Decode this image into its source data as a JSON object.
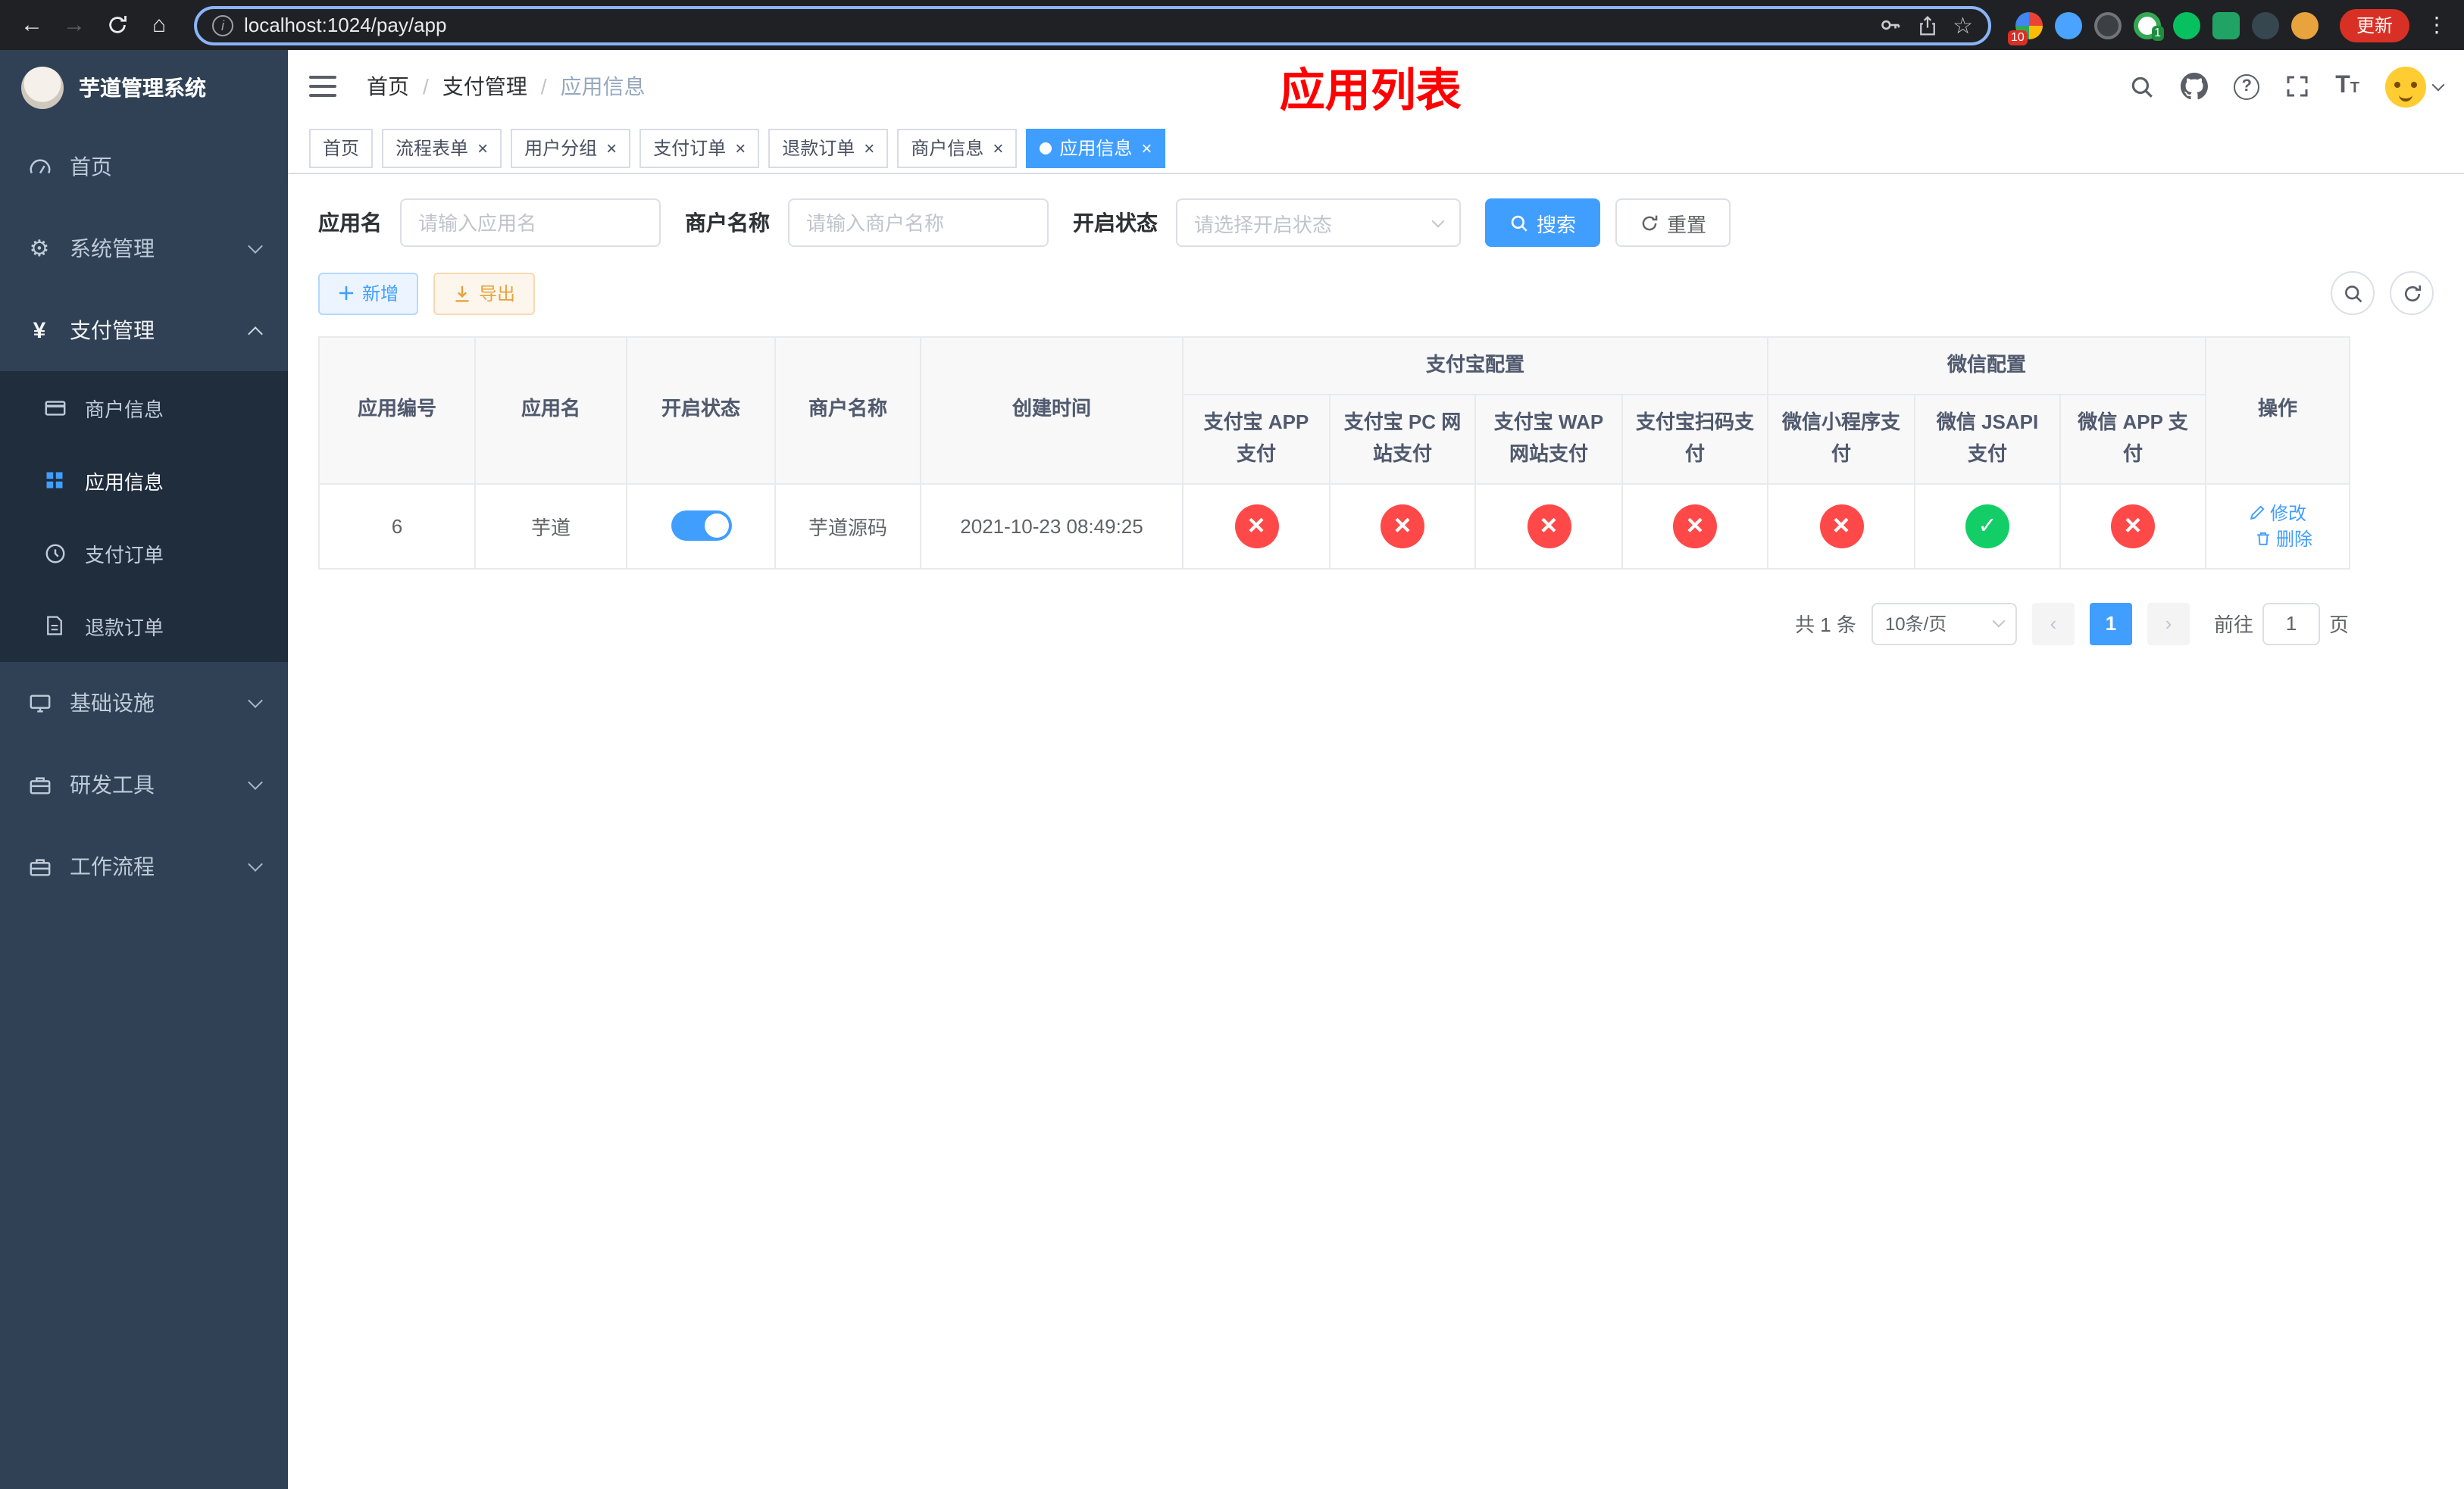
{
  "colors": {
    "primary": "#409eff",
    "success": "#13ce66",
    "danger": "#ff4949",
    "warning": "#e6a23c",
    "banner_red": "#ff0000",
    "sidebar_bg": "#304156",
    "submenu_bg": "#1f2d3d"
  },
  "browser": {
    "url": "localhost:1024/pay/app",
    "update_label": "更新",
    "extension_badge": "10",
    "profile_badge": "1"
  },
  "app": {
    "title": "芋道管理系统"
  },
  "sidebar": {
    "home": "首页",
    "system": "系统管理",
    "payment": "支付管理",
    "merchant_info": "商户信息",
    "app_info": "应用信息",
    "pay_order": "支付订单",
    "refund_order": "退款订单",
    "infra": "基础设施",
    "dev_tools": "研发工具",
    "workflow": "工作流程"
  },
  "breadcrumb": {
    "home": "首页",
    "payment": "支付管理",
    "current": "应用信息",
    "separator": "/"
  },
  "banner": {
    "title": "应用列表"
  },
  "tabs": [
    {
      "label": "首页"
    },
    {
      "label": "流程表单"
    },
    {
      "label": "用户分组"
    },
    {
      "label": "支付订单"
    },
    {
      "label": "退款订单"
    },
    {
      "label": "商户信息"
    },
    {
      "label": "应用信息"
    }
  ],
  "filters": {
    "app_name_label": "应用名",
    "app_name_placeholder": "请输入应用名",
    "merchant_label": "商户名称",
    "merchant_placeholder": "请输入商户名称",
    "status_label": "开启状态",
    "status_placeholder": "请选择开启状态",
    "search_label": "搜索",
    "reset_label": "重置"
  },
  "toolbar": {
    "add_label": "新增",
    "export_label": "导出"
  },
  "table": {
    "group_alipay": "支付宝配置",
    "group_wechat": "微信配置",
    "columns": {
      "app_id": "应用编号",
      "app_name": "应用名",
      "status": "开启状态",
      "merchant": "商户名称",
      "created": "创建时间",
      "alipay_app": "支付宝 APP 支付",
      "alipay_pc": "支付宝 PC 网站支付",
      "alipay_wap": "支付宝 WAP 网站支付",
      "alipay_qr": "支付宝扫码支付",
      "wx_mini": "微信小程序支付",
      "wx_jsapi": "微信 JSAPI 支付",
      "wx_app": "微信 APP 支付",
      "actions": "操作"
    },
    "row": {
      "app_id": "6",
      "app_name": "芋道",
      "enabled_state": "on",
      "merchant": "芋道源码",
      "created": "2021-10-23 08:49:25",
      "alipay_app": "disabled",
      "alipay_pc": "disabled",
      "alipay_wap": "disabled",
      "alipay_qr": "disabled",
      "wx_mini": "disabled",
      "wx_jsapi": "enabled",
      "wx_app": "disabled",
      "edit_label": "修改",
      "delete_label": "删除"
    }
  },
  "pagination": {
    "total": "共 1 条",
    "page_size": "10条/页",
    "page": "1",
    "goto_prefix": "前往",
    "goto_value": "1",
    "goto_suffix": "页"
  }
}
